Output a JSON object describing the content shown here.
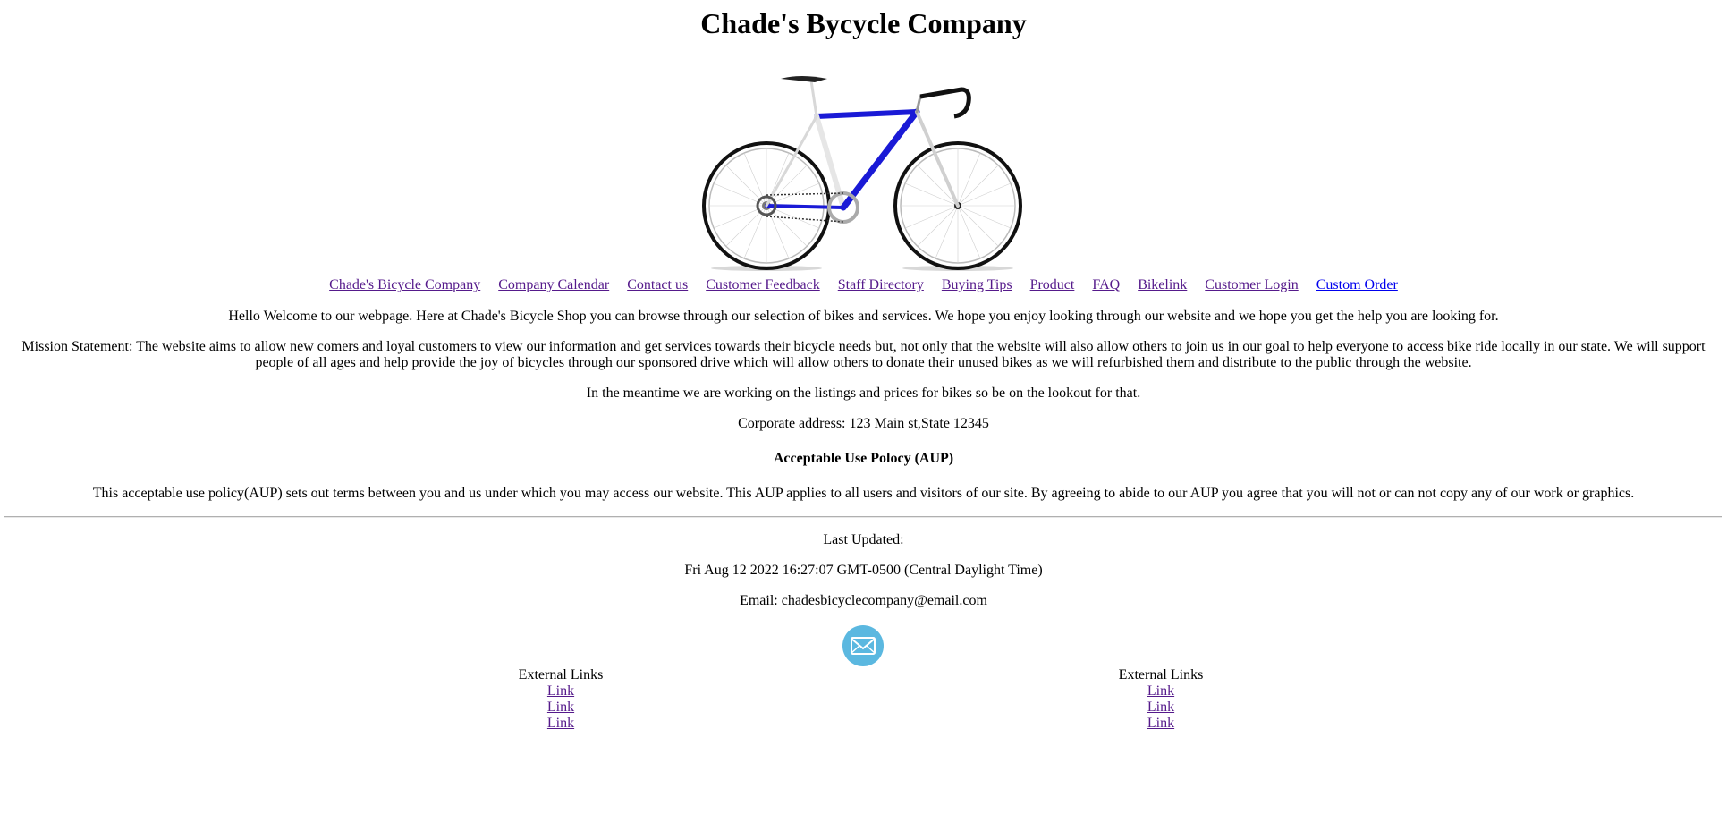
{
  "page_title": "Chade's Bycycle Company",
  "nav": {
    "items": [
      {
        "label": "Chade's Bicycle Company"
      },
      {
        "label": "Company Calendar"
      },
      {
        "label": "Contact us"
      },
      {
        "label": "Customer Feedback"
      },
      {
        "label": "Staff Directory"
      },
      {
        "label": "Buying Tips"
      },
      {
        "label": "Product"
      },
      {
        "label": "FAQ"
      },
      {
        "label": "Bikelink"
      },
      {
        "label": "Customer Login"
      },
      {
        "label": "Custom Order"
      }
    ]
  },
  "content": {
    "welcome": "Hello Welcome to our webpage. Here at Chade's Bicycle Shop you can browse through our selection of bikes and services. We hope you enjoy looking through our website and we hope you get the help you are looking for.",
    "mission": "Mission Statement: The website aims to allow new comers and loyal customers to view our information and get services towards their bicycle needs but, not only that the website will also allow others to join us in our goal to help everyone to access bike ride locally in our state. We will support people of all ages and help provide the joy of bicycles through our sponsored drive which will allow others to donate their unused bikes as we will refurbished them and distribute to the public through the website.",
    "meantime": "In the meantime we are working on the listings and prices for bikes so be on the lookout for that.",
    "address": "Corporate address: 123 Main st,State 12345",
    "aup_heading": "Acceptable Use Polocy (AUP)",
    "aup_text": "This acceptable use policy(AUP) sets out terms between you and us under which you may access our website. This AUP applies to all users and visitors of our site. By agreeing to abide to our AUP you agree that you will not or can not copy any of our work or graphics."
  },
  "footer": {
    "last_updated_label": "Last Updated:",
    "last_updated_value": "Fri Aug 12 2022 16:27:07 GMT-0500 (Central Daylight Time)",
    "email": "Email: chadesbicyclecompany@email.com",
    "mail_icon": "envelope-icon",
    "external_links": [
      {
        "heading": "External Links",
        "links": [
          "Link",
          "Link",
          "Link"
        ]
      },
      {
        "heading": "External Links",
        "links": [
          "Link",
          "Link",
          "Link"
        ]
      }
    ]
  },
  "colors": {
    "visited_link": "#551a8b",
    "unvisited_link": "#0000ee",
    "frame_blue": "#1a1ad6",
    "mail_icon_bg": "#5bb8e0"
  }
}
